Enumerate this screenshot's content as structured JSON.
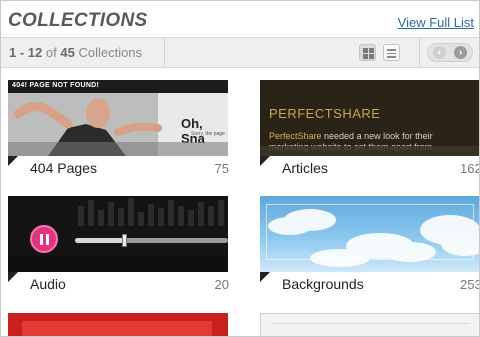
{
  "header": {
    "title": "COLLECTIONS",
    "view_full_list": "View Full List"
  },
  "toolbar": {
    "range_start": "1",
    "range_dash": " - ",
    "range_end": "12",
    "of_label": "of",
    "total": "45",
    "collections_label": "Collections",
    "views": [
      {
        "name": "grid-view",
        "icon": "grid-icon",
        "active": true
      },
      {
        "name": "list-view",
        "icon": "list-icon",
        "active": false
      }
    ],
    "pager": {
      "prev_glyph": "‹",
      "next_glyph": "›"
    }
  },
  "collections": [
    {
      "name": "404 Pages",
      "count": "75",
      "thumb": {
        "banner": "404! PAGE NOT FOUND!",
        "headline": "Oh, Sna",
        "subline": "Sorry, the page"
      }
    },
    {
      "name": "Articles",
      "count": "162",
      "thumb": {
        "heading": "PERFECTSHARE",
        "brand": "PerfectShare",
        "text": " needed a new look for their marketing website to set them apart from"
      }
    },
    {
      "name": "Audio",
      "count": "20",
      "thumb": {
        "playback_progress": 0.32
      }
    },
    {
      "name": "Backgrounds",
      "count": "253",
      "thumb": {}
    }
  ],
  "colors": {
    "link": "#2a6ab0",
    "title": "#5a5a5a",
    "audio_button": "#e5327f",
    "articles_bg": "#2a2418",
    "articles_heading": "#c9a64a",
    "sky_top": "#6fb6e6"
  }
}
